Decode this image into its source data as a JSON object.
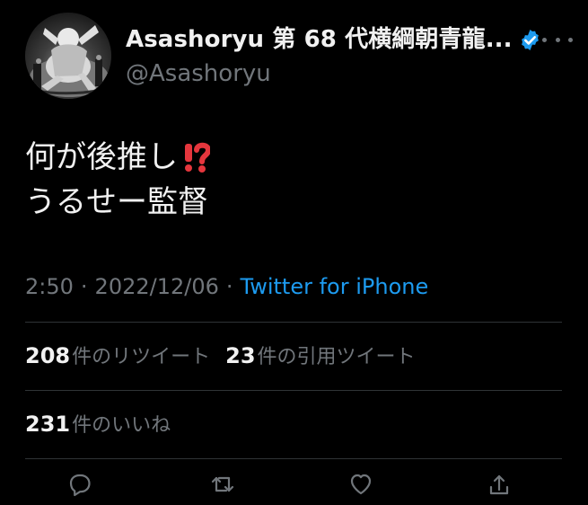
{
  "user": {
    "display_name": "Asashoryu 第 68 代横綱朝青龍...",
    "handle": "@Asashoryu",
    "verified": true,
    "avatar_icon": "sumo-wrestler-avatar",
    "verified_icon": "verified-badge-icon",
    "more_icon": "more-options-icon"
  },
  "tweet": {
    "line1": "何が後推し",
    "line1_emoji": "⁉️",
    "line2": "うるせー監督"
  },
  "meta": {
    "time": "2:50",
    "separator_1": "·",
    "date": "2022/12/06",
    "separator_2": "·",
    "source": "Twitter for iPhone"
  },
  "stats": {
    "retweets": {
      "count": "208",
      "label": "件のリツイート"
    },
    "quote_tweets": {
      "count": "23",
      "label": "件の引用ツイート"
    },
    "likes": {
      "count": "231",
      "label": "件のいいね"
    }
  },
  "actions": [
    {
      "name": "reply",
      "icon": "reply-icon"
    },
    {
      "name": "retweet",
      "icon": "retweet-icon"
    },
    {
      "name": "like",
      "icon": "heart-icon"
    },
    {
      "name": "share",
      "icon": "share-icon"
    }
  ],
  "colors": {
    "background": "#000000",
    "primary_text": "#f1f1f1",
    "secondary_text": "#71767b",
    "link": "#1d9bf0",
    "divider": "#2f3336",
    "emoji_red": "#e5363d"
  }
}
